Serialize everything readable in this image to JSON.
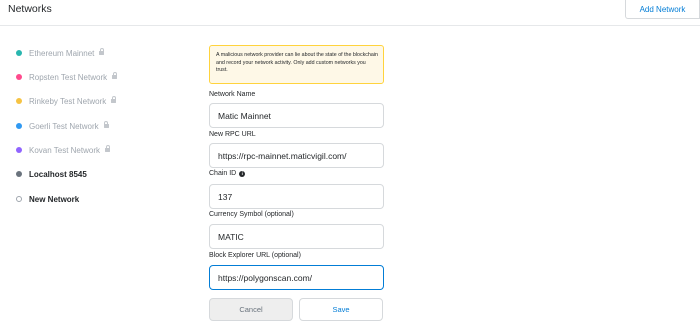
{
  "header": {
    "title": "Networks",
    "add_network_label": "Add Network"
  },
  "sidebar": {
    "items": [
      {
        "label": "Ethereum Mainnet",
        "color": "#29b6af",
        "locked": true,
        "icon": "lock-icon"
      },
      {
        "label": "Ropsten Test Network",
        "color": "#ff4a8d",
        "locked": true,
        "icon": "lock-icon"
      },
      {
        "label": "Rinkeby Test Network",
        "color": "#f6c343",
        "locked": true,
        "icon": "lock-icon"
      },
      {
        "label": "Goerli Test Network",
        "color": "#3099f2",
        "locked": true,
        "icon": "lock-icon"
      },
      {
        "label": "Kovan Test Network",
        "color": "#9064ff",
        "locked": true,
        "icon": "lock-icon"
      },
      {
        "label": "Localhost 8545",
        "color": "#6a737d",
        "locked": false
      },
      {
        "label": "New Network",
        "color": "#ffffff",
        "locked": false,
        "selected": true
      }
    ]
  },
  "warning": {
    "text": "A malicious network provider can lie about the state of the blockchain and record your network activity. Only add custom networks you trust."
  },
  "form": {
    "network_name": {
      "label": "Network Name",
      "value": "Matic Mainnet"
    },
    "rpc_url": {
      "label": "New RPC URL",
      "value": "https://rpc-mainnet.maticvigil.com/"
    },
    "chain_id": {
      "label": "Chain ID",
      "value": "137",
      "info_icon": "info-icon"
    },
    "currency_symbol": {
      "label": "Currency Symbol (optional)",
      "value": "MATIC"
    },
    "block_explorer": {
      "label": "Block Explorer URL (optional)",
      "value": "https://polygonscan.com/"
    }
  },
  "buttons": {
    "cancel_label": "Cancel",
    "save_label": "Save"
  },
  "colors": {
    "accent": "#037dd6",
    "warning_bg": "#fef8e7",
    "warning_border": "#ffd33d"
  }
}
